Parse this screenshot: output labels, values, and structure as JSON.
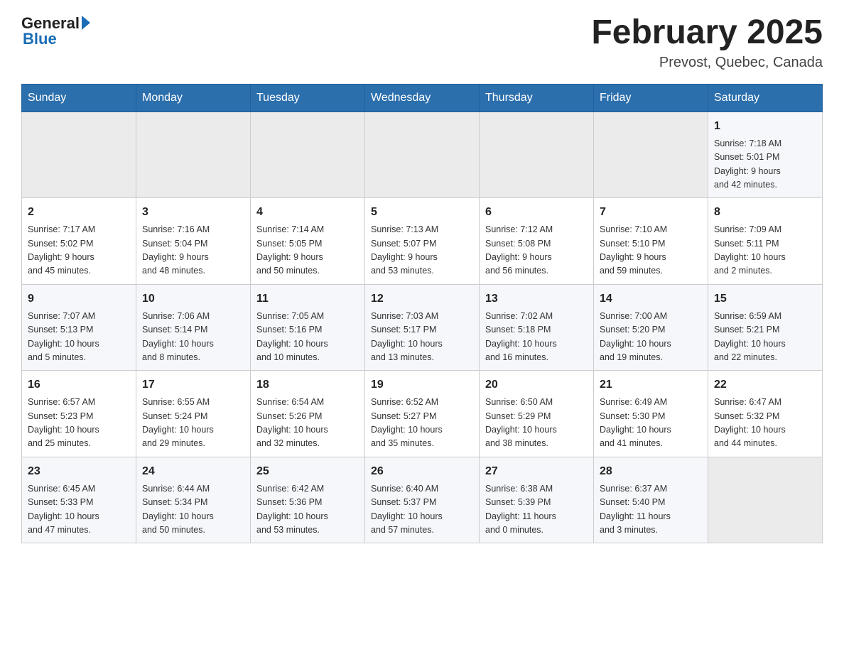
{
  "header": {
    "logo_text_general": "General",
    "logo_text_blue": "Blue",
    "month_title": "February 2025",
    "location": "Prevost, Quebec, Canada"
  },
  "days_of_week": [
    "Sunday",
    "Monday",
    "Tuesday",
    "Wednesday",
    "Thursday",
    "Friday",
    "Saturday"
  ],
  "weeks": [
    {
      "days": [
        {
          "num": "",
          "info": ""
        },
        {
          "num": "",
          "info": ""
        },
        {
          "num": "",
          "info": ""
        },
        {
          "num": "",
          "info": ""
        },
        {
          "num": "",
          "info": ""
        },
        {
          "num": "",
          "info": ""
        },
        {
          "num": "1",
          "info": "Sunrise: 7:18 AM\nSunset: 5:01 PM\nDaylight: 9 hours\nand 42 minutes."
        }
      ]
    },
    {
      "days": [
        {
          "num": "2",
          "info": "Sunrise: 7:17 AM\nSunset: 5:02 PM\nDaylight: 9 hours\nand 45 minutes."
        },
        {
          "num": "3",
          "info": "Sunrise: 7:16 AM\nSunset: 5:04 PM\nDaylight: 9 hours\nand 48 minutes."
        },
        {
          "num": "4",
          "info": "Sunrise: 7:14 AM\nSunset: 5:05 PM\nDaylight: 9 hours\nand 50 minutes."
        },
        {
          "num": "5",
          "info": "Sunrise: 7:13 AM\nSunset: 5:07 PM\nDaylight: 9 hours\nand 53 minutes."
        },
        {
          "num": "6",
          "info": "Sunrise: 7:12 AM\nSunset: 5:08 PM\nDaylight: 9 hours\nand 56 minutes."
        },
        {
          "num": "7",
          "info": "Sunrise: 7:10 AM\nSunset: 5:10 PM\nDaylight: 9 hours\nand 59 minutes."
        },
        {
          "num": "8",
          "info": "Sunrise: 7:09 AM\nSunset: 5:11 PM\nDaylight: 10 hours\nand 2 minutes."
        }
      ]
    },
    {
      "days": [
        {
          "num": "9",
          "info": "Sunrise: 7:07 AM\nSunset: 5:13 PM\nDaylight: 10 hours\nand 5 minutes."
        },
        {
          "num": "10",
          "info": "Sunrise: 7:06 AM\nSunset: 5:14 PM\nDaylight: 10 hours\nand 8 minutes."
        },
        {
          "num": "11",
          "info": "Sunrise: 7:05 AM\nSunset: 5:16 PM\nDaylight: 10 hours\nand 10 minutes."
        },
        {
          "num": "12",
          "info": "Sunrise: 7:03 AM\nSunset: 5:17 PM\nDaylight: 10 hours\nand 13 minutes."
        },
        {
          "num": "13",
          "info": "Sunrise: 7:02 AM\nSunset: 5:18 PM\nDaylight: 10 hours\nand 16 minutes."
        },
        {
          "num": "14",
          "info": "Sunrise: 7:00 AM\nSunset: 5:20 PM\nDaylight: 10 hours\nand 19 minutes."
        },
        {
          "num": "15",
          "info": "Sunrise: 6:59 AM\nSunset: 5:21 PM\nDaylight: 10 hours\nand 22 minutes."
        }
      ]
    },
    {
      "days": [
        {
          "num": "16",
          "info": "Sunrise: 6:57 AM\nSunset: 5:23 PM\nDaylight: 10 hours\nand 25 minutes."
        },
        {
          "num": "17",
          "info": "Sunrise: 6:55 AM\nSunset: 5:24 PM\nDaylight: 10 hours\nand 29 minutes."
        },
        {
          "num": "18",
          "info": "Sunrise: 6:54 AM\nSunset: 5:26 PM\nDaylight: 10 hours\nand 32 minutes."
        },
        {
          "num": "19",
          "info": "Sunrise: 6:52 AM\nSunset: 5:27 PM\nDaylight: 10 hours\nand 35 minutes."
        },
        {
          "num": "20",
          "info": "Sunrise: 6:50 AM\nSunset: 5:29 PM\nDaylight: 10 hours\nand 38 minutes."
        },
        {
          "num": "21",
          "info": "Sunrise: 6:49 AM\nSunset: 5:30 PM\nDaylight: 10 hours\nand 41 minutes."
        },
        {
          "num": "22",
          "info": "Sunrise: 6:47 AM\nSunset: 5:32 PM\nDaylight: 10 hours\nand 44 minutes."
        }
      ]
    },
    {
      "days": [
        {
          "num": "23",
          "info": "Sunrise: 6:45 AM\nSunset: 5:33 PM\nDaylight: 10 hours\nand 47 minutes."
        },
        {
          "num": "24",
          "info": "Sunrise: 6:44 AM\nSunset: 5:34 PM\nDaylight: 10 hours\nand 50 minutes."
        },
        {
          "num": "25",
          "info": "Sunrise: 6:42 AM\nSunset: 5:36 PM\nDaylight: 10 hours\nand 53 minutes."
        },
        {
          "num": "26",
          "info": "Sunrise: 6:40 AM\nSunset: 5:37 PM\nDaylight: 10 hours\nand 57 minutes."
        },
        {
          "num": "27",
          "info": "Sunrise: 6:38 AM\nSunset: 5:39 PM\nDaylight: 11 hours\nand 0 minutes."
        },
        {
          "num": "28",
          "info": "Sunrise: 6:37 AM\nSunset: 5:40 PM\nDaylight: 11 hours\nand 3 minutes."
        },
        {
          "num": "",
          "info": ""
        }
      ]
    }
  ]
}
